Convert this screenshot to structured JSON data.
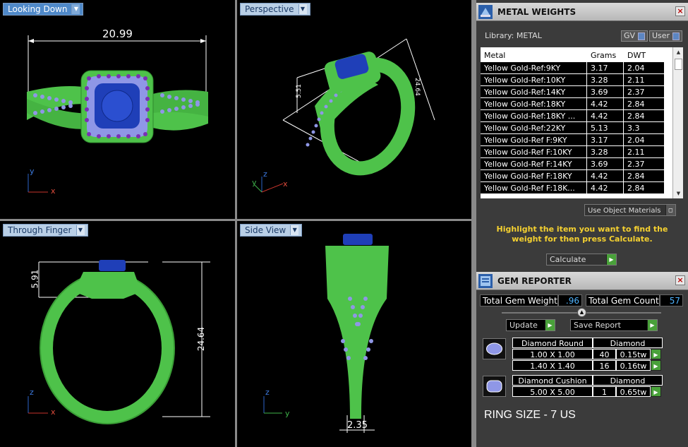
{
  "viewports": {
    "top_left": {
      "label": "Looking Down",
      "dims": [
        "20.99"
      ],
      "axes": [
        "y",
        "x"
      ]
    },
    "top_right": {
      "label": "Perspective",
      "dims": [
        "5.51",
        "24.64"
      ],
      "axes": [
        "z",
        "y",
        "x"
      ]
    },
    "bottom_left": {
      "label": "Through Finger",
      "dims": [
        "5.91",
        "24.64"
      ],
      "axes": [
        "z",
        "x"
      ]
    },
    "bottom_right": {
      "label": "Side View",
      "dims": [
        "2.35"
      ],
      "axes": [
        "z",
        "y"
      ]
    }
  },
  "metal_weights": {
    "title": "METAL WEIGHTS",
    "library_label": "Library: METAL",
    "gv_label": "GV",
    "user_label": "User",
    "columns": [
      "Metal",
      "Grams",
      "DWT"
    ],
    "rows": [
      [
        "Yellow Gold-Ref:9KY",
        "3.17",
        "2.04"
      ],
      [
        "Yellow Gold-Ref:10KY",
        "3.28",
        "2.11"
      ],
      [
        "Yellow Gold-Ref:14KY",
        "3.69",
        "2.37"
      ],
      [
        "Yellow Gold-Ref:18KY",
        "4.42",
        "2.84"
      ],
      [
        "Yellow Gold-Ref:18KY ...",
        "4.42",
        "2.84"
      ],
      [
        "Yellow Gold-Ref:22KY",
        "5.13",
        "3.3"
      ],
      [
        "Yellow Gold-Ref F:9KY",
        "3.17",
        "2.04"
      ],
      [
        "Yellow Gold-Ref F:10KY",
        "3.28",
        "2.11"
      ],
      [
        "Yellow Gold-Ref F:14KY",
        "3.69",
        "2.37"
      ],
      [
        "Yellow Gold-Ref F:18KY",
        "4.42",
        "2.84"
      ],
      [
        "Yellow Gold-Ref F:18K...",
        "4.42",
        "2.84"
      ]
    ],
    "use_object_materials": "Use Object Materials",
    "hint": "Highlight the item you want to find the weight for then press Calculate.",
    "calculate": "Calculate"
  },
  "gem_reporter": {
    "title": "GEM REPORTER",
    "total_weight_label": "Total Gem Weight",
    "total_weight": ".96",
    "total_count_label": "Total Gem Count",
    "total_count": "57",
    "update": "Update",
    "save_report": "Save Report",
    "groups": [
      {
        "shape": "Diamond Round",
        "type": "Diamond",
        "rows": [
          [
            "1.00 X 1.00",
            "40",
            "0.15tw"
          ],
          [
            "1.40 X 1.40",
            "16",
            "0.16tw"
          ]
        ]
      },
      {
        "shape": "Diamond Cushion",
        "type": "Diamond",
        "rows": [
          [
            "5.00 X 5.00",
            "1",
            "0.65tw"
          ]
        ]
      }
    ],
    "ring_size": "RING SIZE - 7 US"
  },
  "colors": {
    "ring": "#4ec24a",
    "stone": "#1f3fb8",
    "melee": "#8f97e6",
    "prong": "#7a2fb5",
    "accent": "#f5d130"
  }
}
